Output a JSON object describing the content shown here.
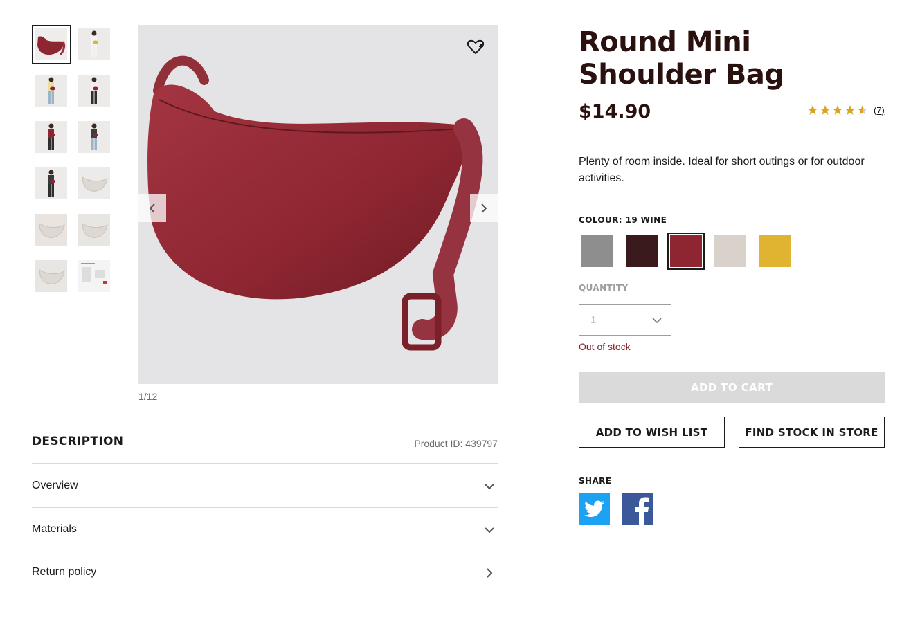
{
  "thumbnails": [
    {
      "name": "thumb-bag-front",
      "active": true
    },
    {
      "name": "thumb-model-1"
    },
    {
      "name": "thumb-model-2"
    },
    {
      "name": "thumb-model-3"
    },
    {
      "name": "thumb-model-4"
    },
    {
      "name": "thumb-model-5"
    },
    {
      "name": "thumb-model-6"
    },
    {
      "name": "thumb-bag-open"
    },
    {
      "name": "thumb-bag-inside"
    },
    {
      "name": "thumb-bag-side"
    },
    {
      "name": "thumb-bag-strap"
    },
    {
      "name": "thumb-size-chart"
    }
  ],
  "gallery": {
    "counter": "1/12",
    "wish_icon": "heart-plus-icon",
    "prev_icon": "chevron-left-icon",
    "next_icon": "chevron-right-icon"
  },
  "description": {
    "title": "DESCRIPTION",
    "product_id": "Product ID: 439797",
    "sections": [
      {
        "label": "Overview",
        "icon": "chevron-down-icon"
      },
      {
        "label": "Materials",
        "icon": "chevron-down-icon"
      },
      {
        "label": "Return policy",
        "icon": "chevron-right-icon"
      }
    ]
  },
  "product": {
    "title": "Round Mini Shoulder Bag",
    "price": "$14.90",
    "rating": 4.5,
    "rating_count": "(7)",
    "blurb": "Plenty of room inside. Ideal for short outings or for outdoor activities.",
    "colour_label": "COLOUR: 19 WINE",
    "colours": [
      {
        "name": "gray",
        "hex": "#8e8e8e"
      },
      {
        "name": "dark-brown",
        "hex": "#3a1a1c"
      },
      {
        "name": "wine",
        "hex": "#8e2631",
        "selected": true
      },
      {
        "name": "natural",
        "hex": "#d8d2cb"
      },
      {
        "name": "yellow",
        "hex": "#e0b330"
      }
    ],
    "quantity_label": "QUANTITY",
    "quantity_value": "1",
    "stock_status": "Out of stock",
    "add_to_cart": "ADD TO CART",
    "add_to_wishlist": "ADD TO WISH LIST",
    "find_stock": "FIND STOCK IN STORE",
    "share_label": "SHARE"
  },
  "colors": {
    "brand_dark": "#2b1010",
    "star": "#d9a521",
    "error": "#8b1d1d",
    "twitter": "#1da1f2",
    "facebook": "#3b5998",
    "disabled": "#dadada"
  }
}
